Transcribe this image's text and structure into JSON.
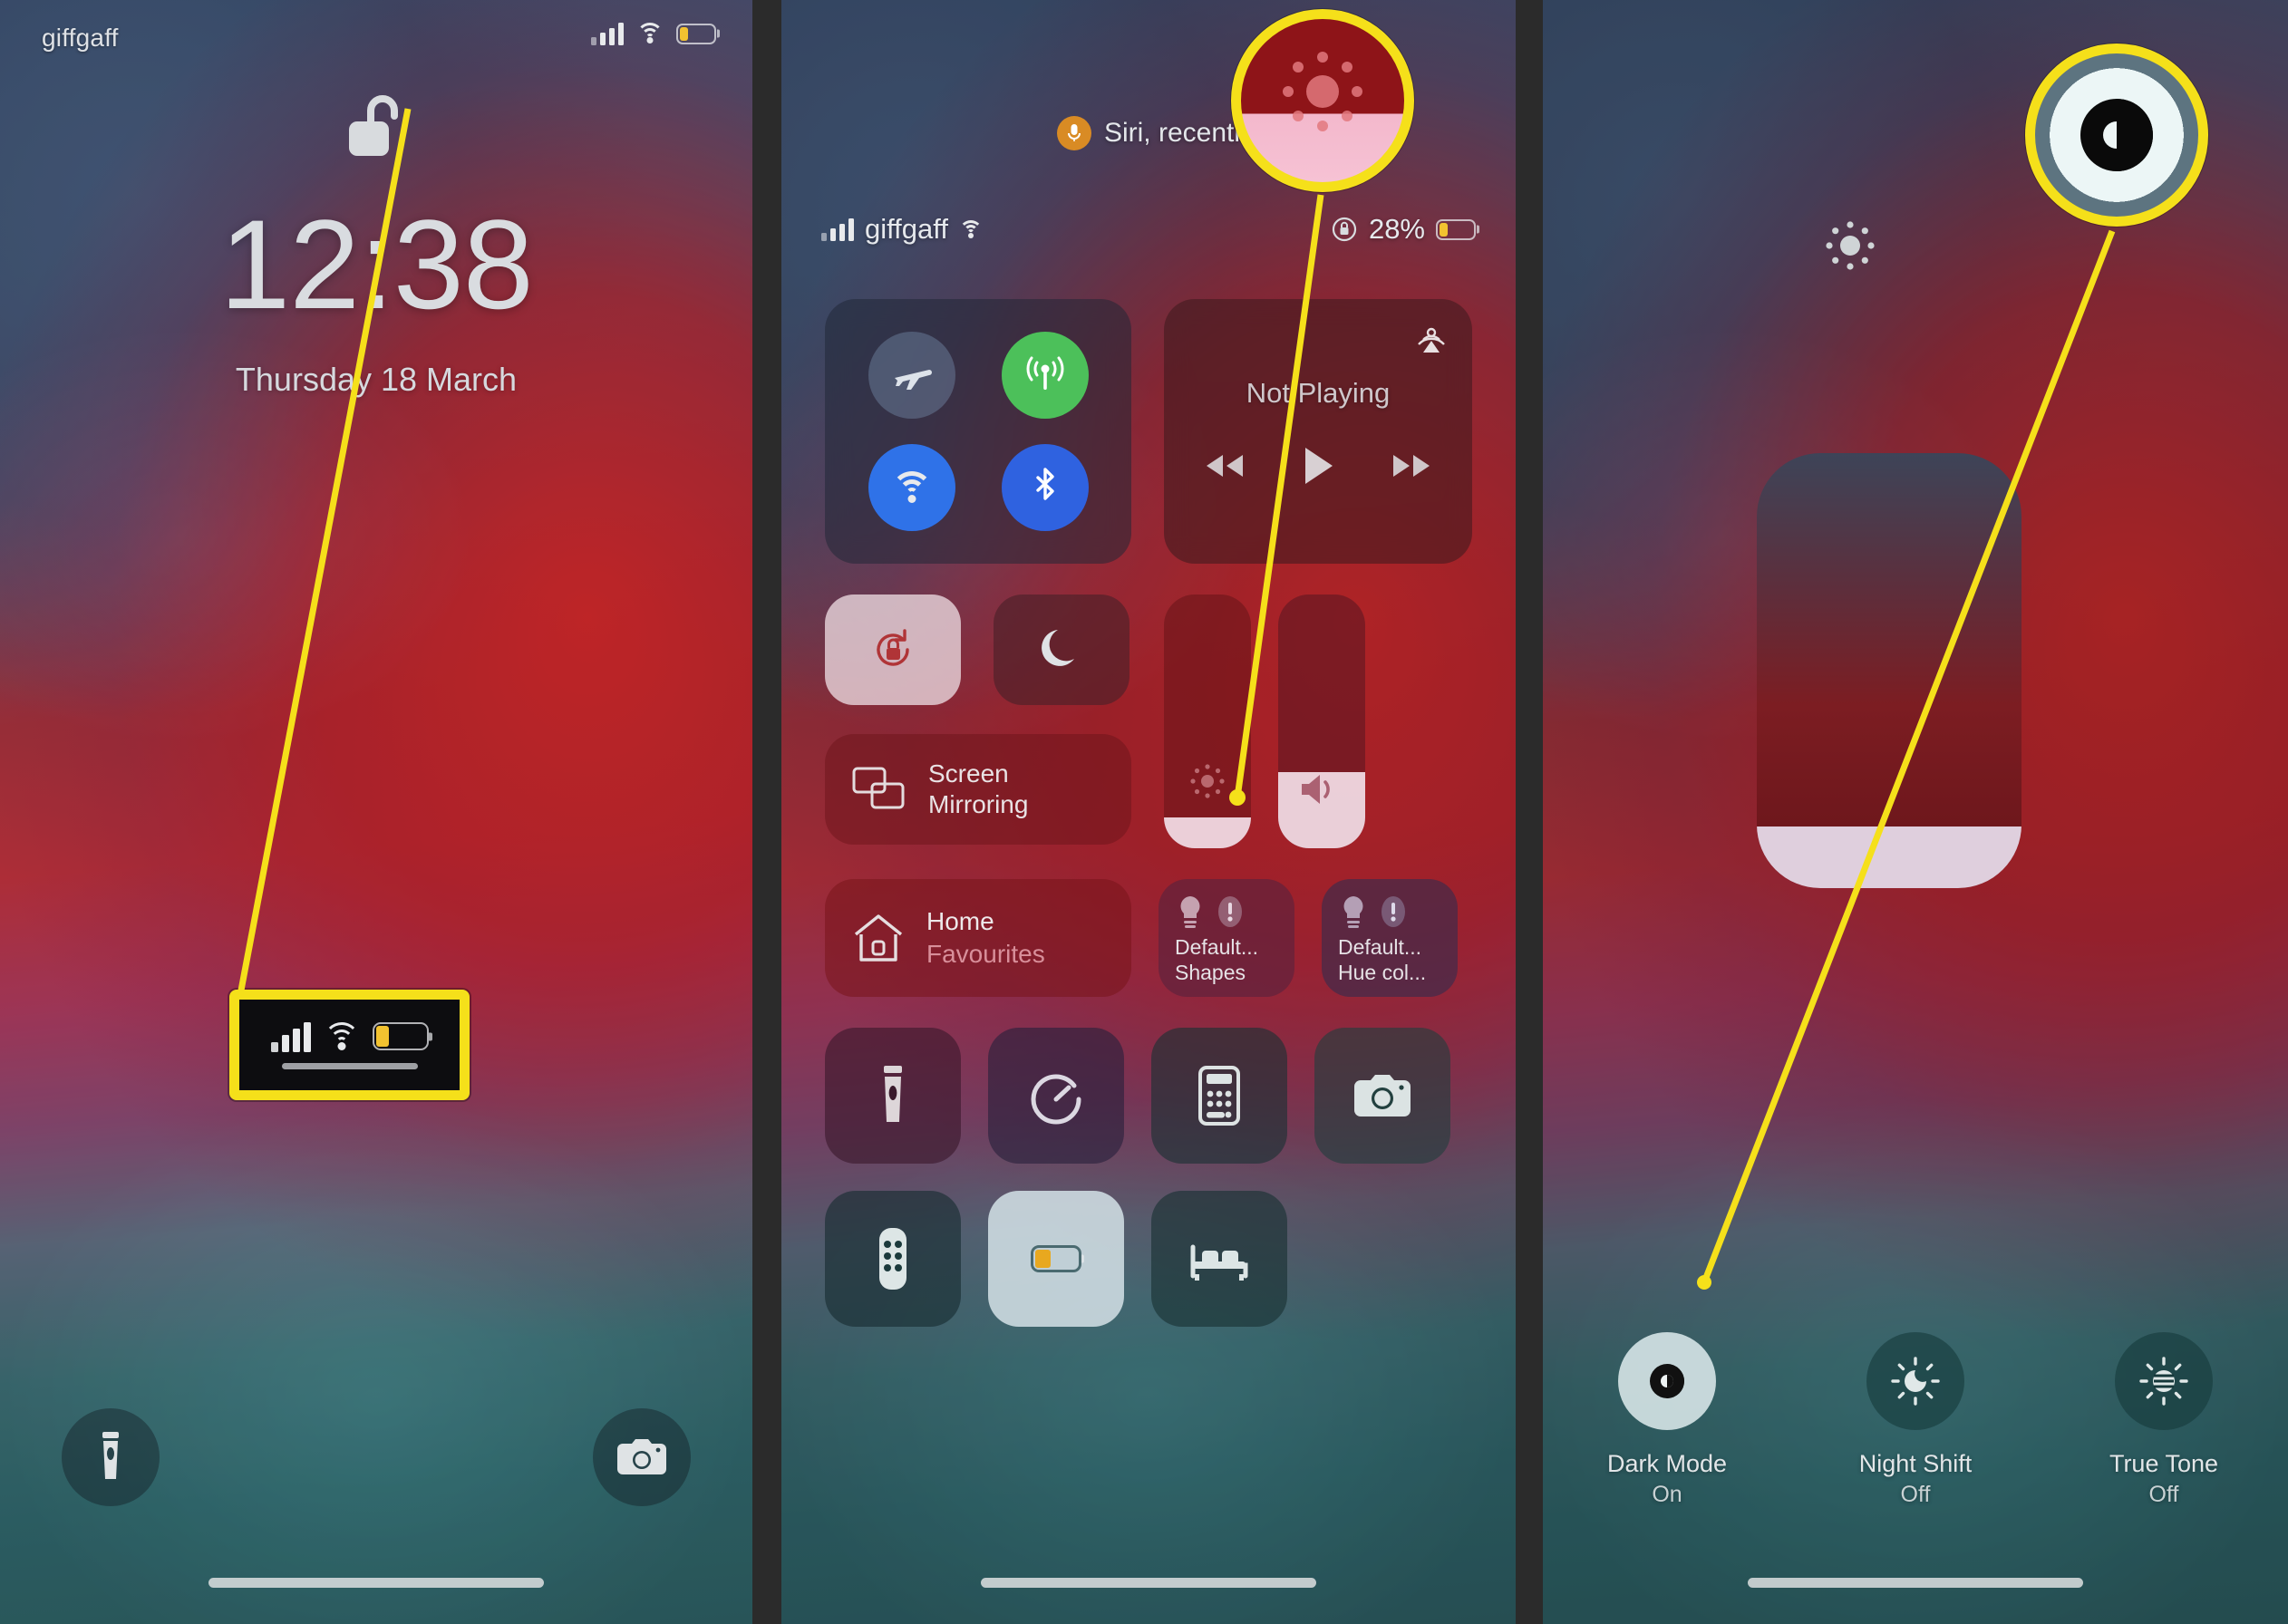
{
  "panels": {
    "lockscreen": {
      "carrier": "giffgaff",
      "time": "12:38",
      "date": "Thursday 18 March",
      "lock_icon": "unlocked-lock-icon",
      "status": {
        "signal": "signal-bars-icon",
        "wifi": "wifi-icon",
        "battery": "battery-low-icon"
      },
      "shortcuts": [
        {
          "name": "flashlight-shortcut",
          "icon": "flashlight-icon"
        },
        {
          "name": "camera-shortcut",
          "icon": "camera-icon"
        }
      ],
      "callout_label": "status-bar-zoom-callout"
    },
    "controlcenter": {
      "siri_banner": "Siri, recentl",
      "siri_icon": "microphone-icon",
      "carrier": "giffgaff",
      "battery_percent": "28%",
      "rotation_lock_icon": "rotation-lock-icon",
      "connectivity": [
        {
          "name": "airplane-mode-toggle",
          "icon": "airplane-icon",
          "state": "off"
        },
        {
          "name": "cellular-data-toggle",
          "icon": "cellular-icon",
          "state": "on"
        },
        {
          "name": "wifi-toggle",
          "icon": "wifi-icon",
          "state": "on"
        },
        {
          "name": "bluetooth-toggle",
          "icon": "bluetooth-icon",
          "state": "on"
        }
      ],
      "media": {
        "title": "Not Playing",
        "airplay_icon": "airplay-icon",
        "prev": "rewind-icon",
        "play": "play-icon",
        "next": "fast-forward-icon"
      },
      "rotation_tile": "rotation-lock-tile",
      "dnd_tile": "do-not-disturb-tile",
      "screen_mirroring": {
        "line1": "Screen",
        "line2": "Mirroring",
        "icon": "screen-mirroring-icon"
      },
      "brightness_slider": {
        "name": "brightness-slider",
        "icon": "brightness-icon",
        "level_percent": 12
      },
      "volume_slider": {
        "name": "volume-slider",
        "icon": "speaker-icon",
        "level_percent": 30
      },
      "home_tile": {
        "line1": "Home",
        "line2": "Favourites",
        "icon": "home-icon"
      },
      "accessory_tiles": [
        {
          "line1": "Default...",
          "line2": "Shapes",
          "icon": "lightbulb-icon",
          "badge": "alert-icon"
        },
        {
          "line1": "Default...",
          "line2": "Hue col...",
          "icon": "lightbulb-icon",
          "badge": "alert-icon"
        }
      ],
      "apps": [
        {
          "name": "flashlight-button",
          "icon": "flashlight-icon",
          "state": "off"
        },
        {
          "name": "timer-button",
          "icon": "timer-icon",
          "state": "off"
        },
        {
          "name": "calculator-button",
          "icon": "calculator-icon",
          "state": "off"
        },
        {
          "name": "camera-button",
          "icon": "camera-icon",
          "state": "off"
        },
        {
          "name": "apple-tv-remote-button",
          "icon": "remote-icon",
          "state": "off"
        },
        {
          "name": "low-power-mode-button",
          "icon": "battery-icon",
          "state": "on"
        },
        {
          "name": "sleep-mode-button",
          "icon": "bed-icon",
          "state": "off"
        }
      ]
    },
    "brightness_expanded": {
      "brightness_icon": "brightness-icon",
      "slider": {
        "name": "brightness-slider-expanded",
        "level_percent": 14
      },
      "options": [
        {
          "label": "Dark Mode",
          "state": "On",
          "icon": "dark-mode-icon",
          "active": true
        },
        {
          "label": "Night Shift",
          "state": "Off",
          "icon": "night-shift-icon",
          "active": false
        },
        {
          "label": "True Tone",
          "state": "Off",
          "icon": "true-tone-icon",
          "active": false
        }
      ]
    }
  },
  "annotations": {
    "highlight_color": "#f5e01a",
    "callouts": [
      {
        "name": "status-bar-callout",
        "target": "lockscreen-status-bar"
      },
      {
        "name": "brightness-callout",
        "target": "controlcenter-brightness-slider"
      },
      {
        "name": "dark-mode-callout",
        "target": "dark-mode-toggle"
      }
    ]
  }
}
